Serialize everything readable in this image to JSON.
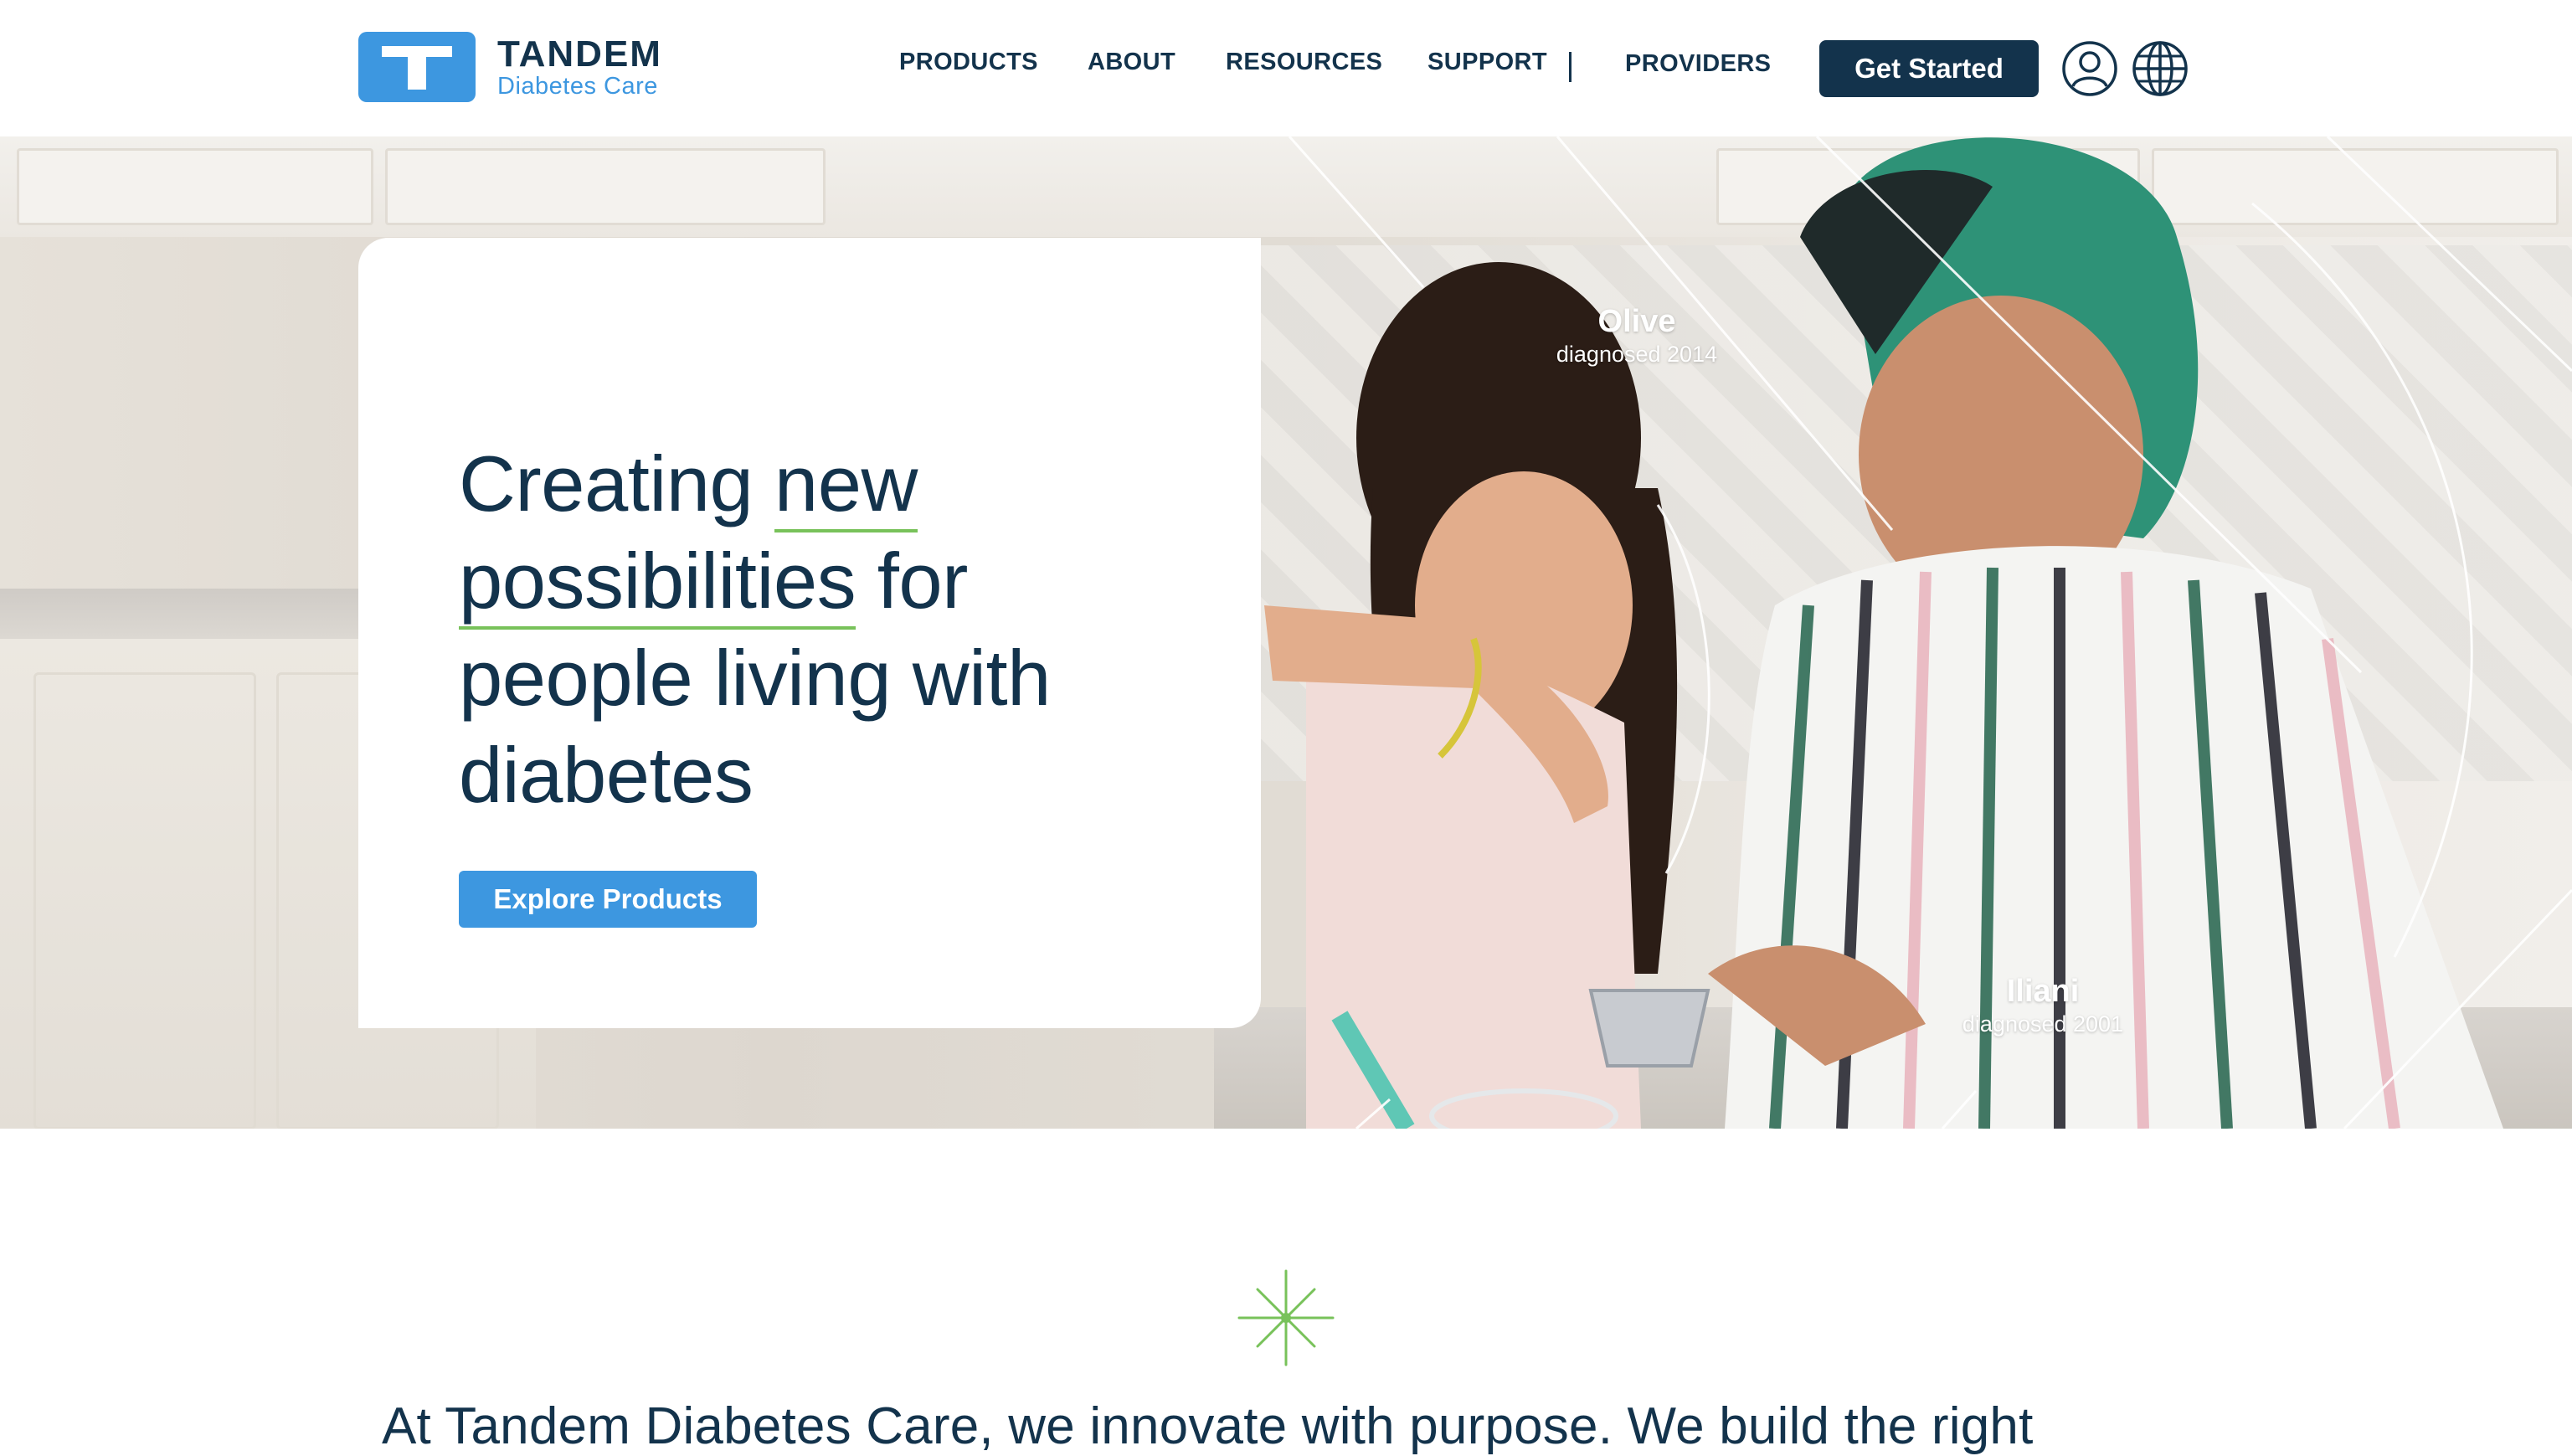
{
  "brand": {
    "name": "TANDEM",
    "subtitle": "Diabetes Care",
    "primary_color": "#3d97e0",
    "navy_color": "#13334c",
    "accent_green": "#78c25a",
    "logo_icon": "t-logo-icon"
  },
  "nav": {
    "items": [
      {
        "label": "PRODUCTS"
      },
      {
        "label": "ABOUT"
      },
      {
        "label": "RESOURCES"
      },
      {
        "label": "SUPPORT"
      },
      {
        "label": "PROVIDERS"
      }
    ],
    "cta_label": "Get Started",
    "account_icon": "user-icon",
    "language_icon": "globe-icon"
  },
  "hero": {
    "title_parts": [
      "Creating ",
      "new",
      " ",
      "possibilities",
      " for people living with diabetes"
    ],
    "button_label": "Explore Products",
    "people": [
      {
        "name": "Olive",
        "diagnosed": "diagnosed 2014"
      },
      {
        "name": "Iliani",
        "diagnosed": "diagnosed 2001"
      }
    ]
  },
  "intro": {
    "icon": "sparkle-icon",
    "text": "At Tandem Diabetes Care, we innovate with purpose. We build the right"
  }
}
